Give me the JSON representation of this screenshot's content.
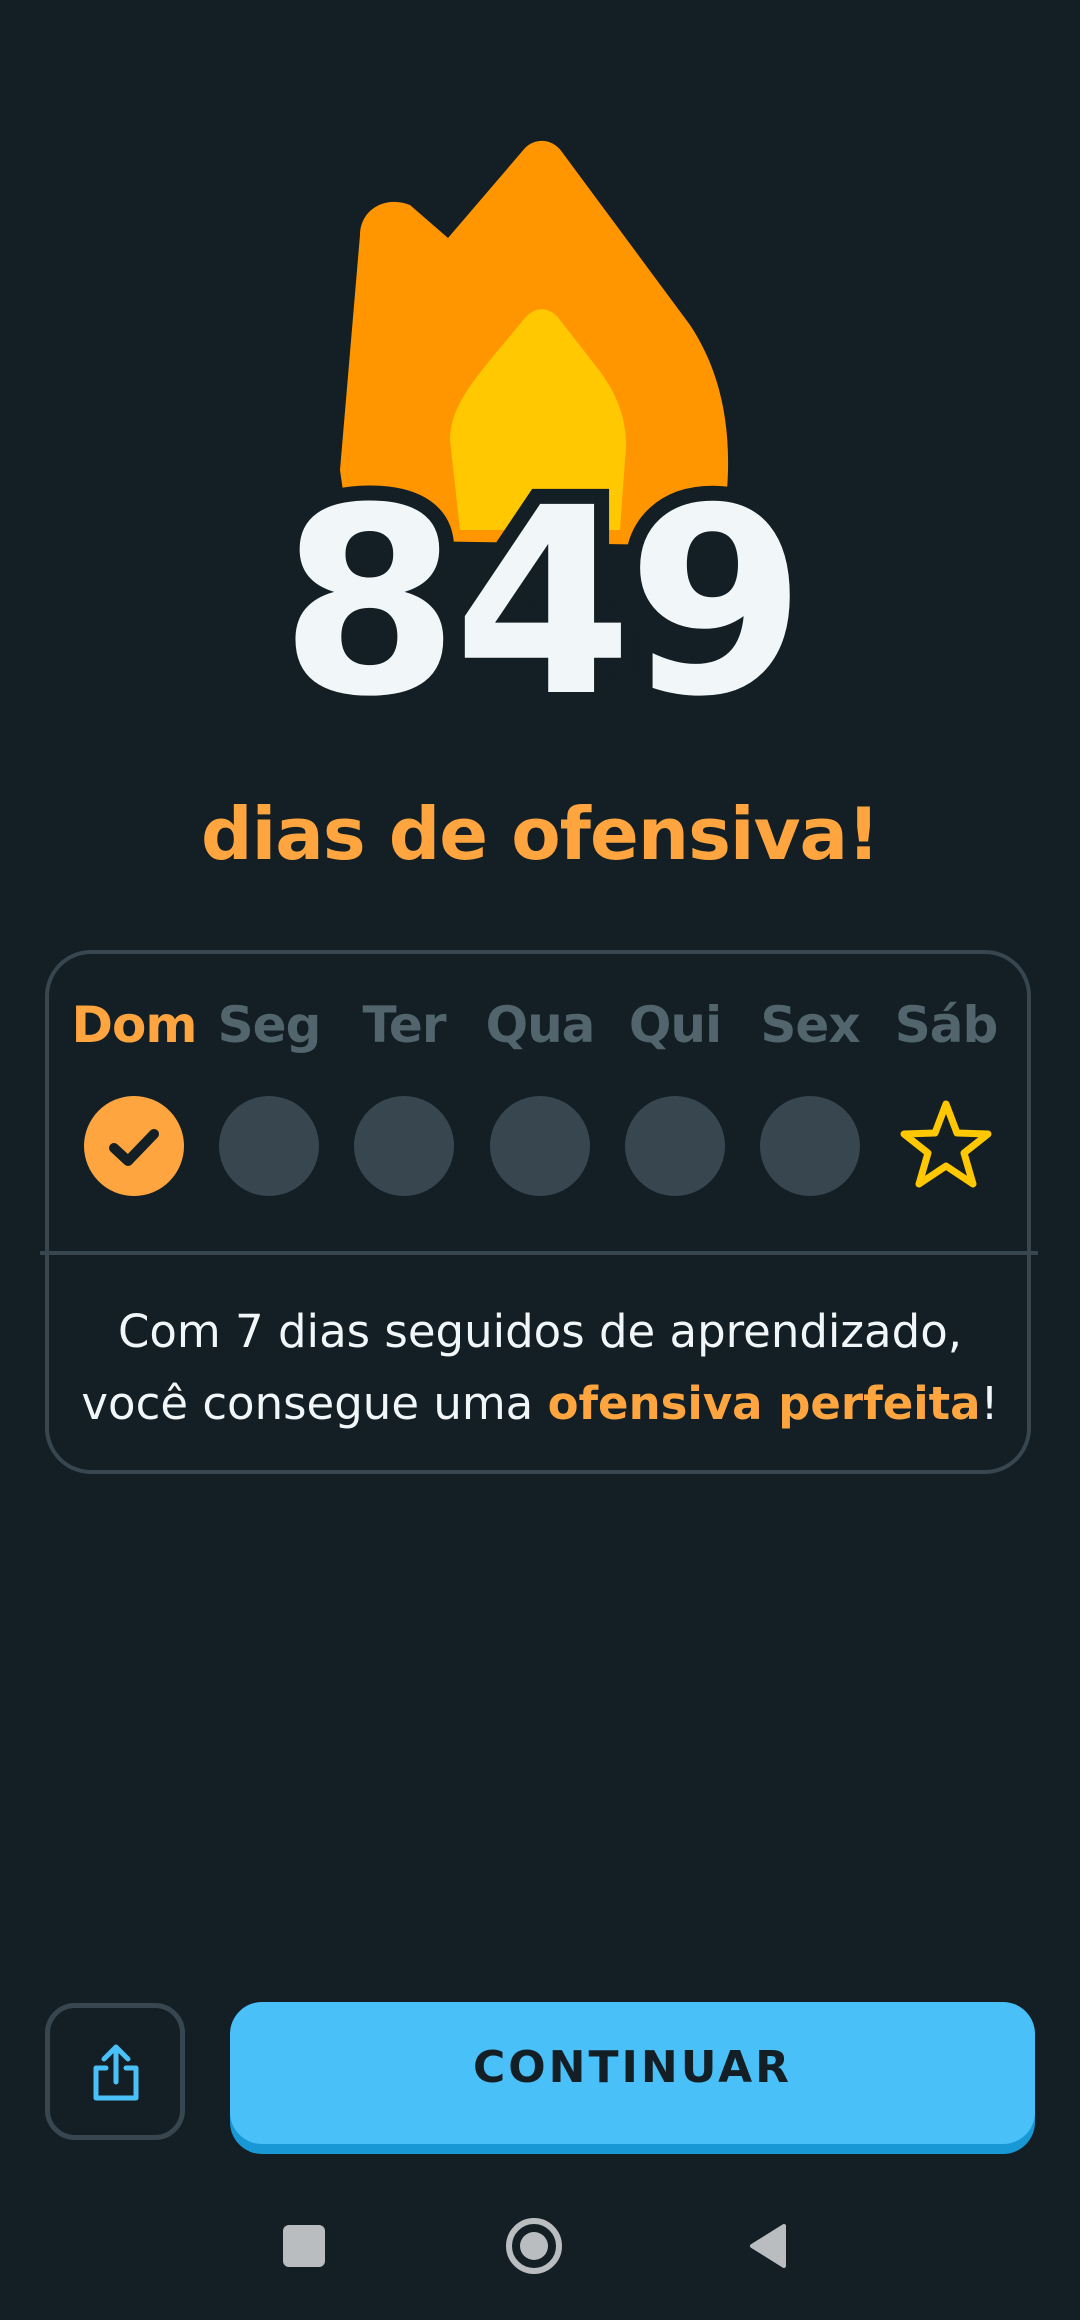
{
  "streak": {
    "count": "849",
    "title": "dias de ofensiva!"
  },
  "week": {
    "days": [
      {
        "label": "Dom",
        "state": "done"
      },
      {
        "label": "Seg",
        "state": "empty"
      },
      {
        "label": "Ter",
        "state": "empty"
      },
      {
        "label": "Qua",
        "state": "empty"
      },
      {
        "label": "Qui",
        "state": "empty"
      },
      {
        "label": "Sex",
        "state": "empty"
      },
      {
        "label": "Sáb",
        "state": "star"
      }
    ],
    "hint_line1": "Com 7 dias seguidos de aprendizado,",
    "hint_line2_prefix": "você consegue uma ",
    "hint_highlight": "ofensiva perfeita",
    "hint_suffix": "!"
  },
  "actions": {
    "share_icon": "share-icon",
    "continue_label": "CONTINUAR"
  },
  "navbar": {
    "icons": [
      "recent-apps-icon",
      "home-icon",
      "back-icon"
    ]
  },
  "colors": {
    "background": "#131F24",
    "accent_orange": "#FFA53F",
    "button_blue": "#49C0F8",
    "inactive": "#37464F"
  }
}
